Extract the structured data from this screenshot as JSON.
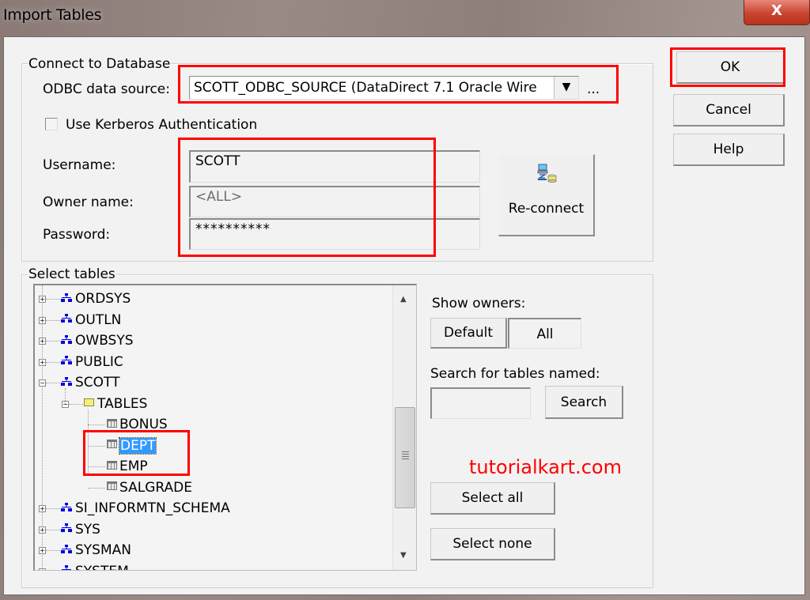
{
  "window": {
    "title": "Import Tables",
    "close_label": "X"
  },
  "dialog_buttons": {
    "ok": "OK",
    "cancel": "Cancel",
    "help": "Help"
  },
  "connect": {
    "group_label": "Connect to Database",
    "odbc_label": "ODBC data source:",
    "odbc_value": "SCOTT_ODBC_SOURCE (DataDirect 7.1 Oracle Wire",
    "browse_label": "...",
    "kerberos_label": "Use Kerberos Authentication",
    "kerberos_checked": false,
    "username_label": "Username:",
    "username_value": "SCOTT",
    "owner_label": "Owner name:",
    "owner_value": "<ALL>",
    "password_label": "Password:",
    "password_value": "**********",
    "reconnect_label": "Re-connect"
  },
  "tables": {
    "group_label": "Select tables",
    "tree": [
      {
        "label": "ORDSYS",
        "type": "schema",
        "expanded": false
      },
      {
        "label": "OUTLN",
        "type": "schema",
        "expanded": false
      },
      {
        "label": "OWBSYS",
        "type": "schema",
        "expanded": false
      },
      {
        "label": "PUBLIC",
        "type": "schema",
        "expanded": false
      },
      {
        "label": "SCOTT",
        "type": "schema",
        "expanded": true
      },
      {
        "label": "TABLES",
        "type": "folder",
        "expanded": true
      },
      {
        "label": "BONUS",
        "type": "table"
      },
      {
        "label": "DEPT",
        "type": "table",
        "selected": true
      },
      {
        "label": "EMP",
        "type": "table"
      },
      {
        "label": "SALGRADE",
        "type": "table"
      },
      {
        "label": "SI_INFORMTN_SCHEMA",
        "type": "schema",
        "expanded": false
      },
      {
        "label": "SYS",
        "type": "schema",
        "expanded": false
      },
      {
        "label": "SYSMAN",
        "type": "schema",
        "expanded": false
      },
      {
        "label": "SYSTEM",
        "type": "schema",
        "expanded": false
      }
    ],
    "show_owners_label": "Show owners:",
    "owner_default": "Default",
    "owner_all": "All",
    "owner_selected": "All",
    "search_label": "Search for tables named:",
    "search_value": "",
    "search_button": "Search",
    "select_all": "Select all",
    "select_none": "Select none"
  },
  "watermark": "tutorialkart.com",
  "colors": {
    "highlight": "#ff0000",
    "selection": "#3399ff",
    "watermark": "#ff0000"
  }
}
